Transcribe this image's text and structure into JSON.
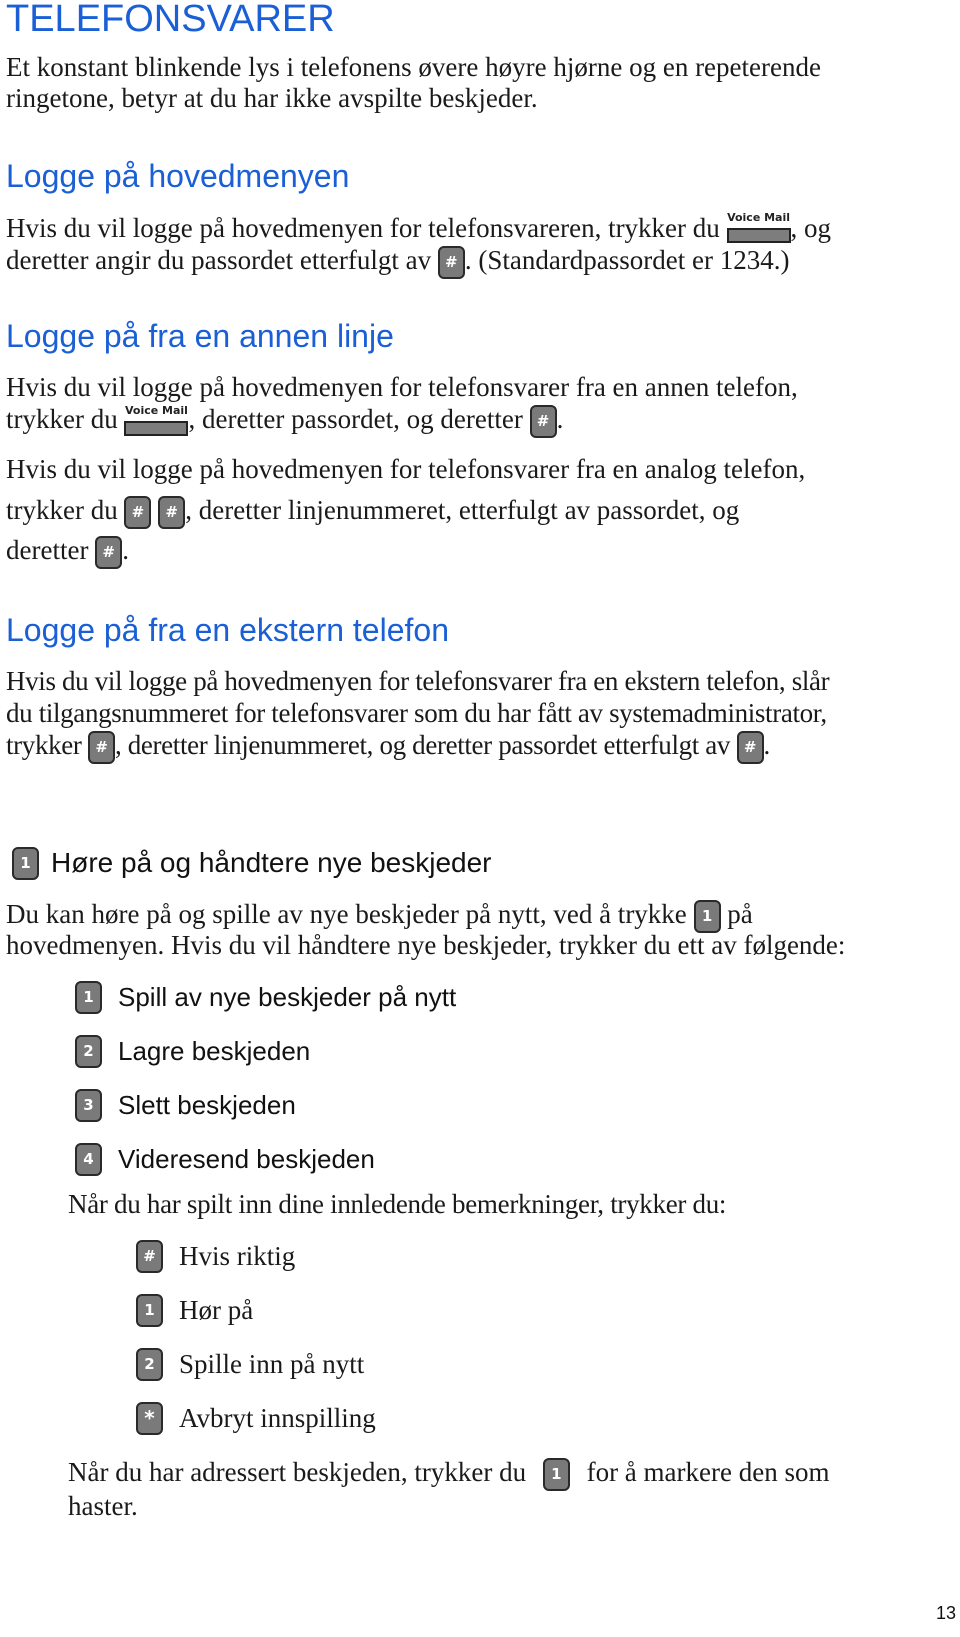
{
  "title": "TELEFONSVARER",
  "intro": {
    "line1": "Et konstant blinkende lys i telefonens øvere høyre hjørne og en repeterende",
    "line2": "ringetone, betyr at du har ikke avspilte beskjeder."
  },
  "keys": {
    "voice_mail": "Voice Mail",
    "hash": "#",
    "star": "*",
    "one": "1",
    "two": "2",
    "three": "3",
    "four": "4"
  },
  "section_main_menu": {
    "heading": "Logge på hovedmenyen",
    "l1a": "Hvis du vil logge på hovedmenyen for telefonsvareren, trykker du",
    "l1b": ", og",
    "l2a": "deretter angir du passordet etterfulgt av",
    "l2b": ". (Standardpassordet er 1234.)"
  },
  "section_other_line": {
    "heading": "Logge på fra en annen linje",
    "p1_l1": "Hvis du vil logge på hovedmenyen for telefonsvarer fra en annen telefon,",
    "p1_l2a": "trykker du",
    "p1_l2b": ", deretter passordet, og deretter",
    "p1_l2c": ".",
    "p2_l1": "Hvis du vil logge på hovedmenyen for telefonsvarer fra en analog telefon,",
    "p2_l2a": "trykker du",
    "p2_l2b": ", deretter linjenummeret, etterfulgt av passordet, og",
    "p2_l3a": "deretter",
    "p2_l3b": "."
  },
  "section_external": {
    "heading": "Logge på fra en ekstern telefon",
    "l1": "Hvis du vil logge på hovedmenyen for telefonsvarer fra en ekstern telefon, slår",
    "l2": "du tilgangsnummeret for telefonsvarer som du har fått av systemadministrator,",
    "l3a": "trykker",
    "l3b": ", deretter linjenummeret, og deretter passordet etterfulgt av",
    "l3c": "."
  },
  "section_new_messages": {
    "heading_key": "1",
    "heading": "Høre på og håndtere nye beskjeder",
    "l1a": "Du kan høre på og spille av nye beskjeder på nytt, ved å trykke",
    "l1b": "på",
    "l2": "hovedmenyen. Hvis du vil håndtere nye beskjeder, trykker du ett av følgende:",
    "options": [
      {
        "key": "1",
        "label": "Spill av nye beskjeder på nytt"
      },
      {
        "key": "2",
        "label": "Lagre beskjeden"
      },
      {
        "key": "3",
        "label": "Slett beskjeden"
      },
      {
        "key": "4",
        "label": "Videresend beskjeden"
      }
    ],
    "after_intro": "Når du har spilt inn dine innledende bemerkninger, trykker du:",
    "sub_options": [
      {
        "key": "#",
        "label": "Hvis riktig"
      },
      {
        "key": "1",
        "label": "Hør på"
      },
      {
        "key": "2",
        "label": "Spille inn på nytt"
      },
      {
        "key": "*",
        "label": "Avbryt innspilling"
      }
    ],
    "urgent_a": "Når du har adressert beskjeden, trykker du",
    "urgent_b": "for å markere den som",
    "urgent_c": "haster."
  },
  "page_number": "13"
}
